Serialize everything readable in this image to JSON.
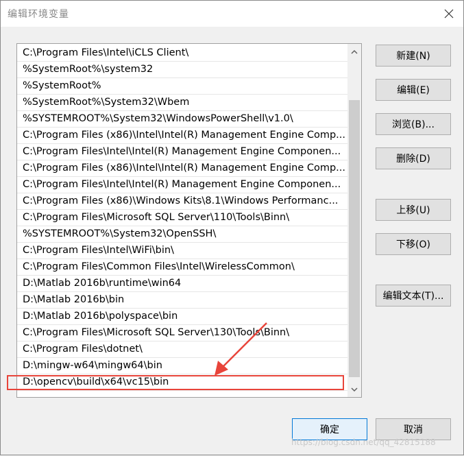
{
  "window": {
    "title": "编辑环境变量"
  },
  "list": {
    "items": [
      "C:\\Program Files\\Intel\\iCLS Client\\",
      "%SystemRoot%\\system32",
      "%SystemRoot%",
      "%SystemRoot%\\System32\\Wbem",
      "%SYSTEMROOT%\\System32\\WindowsPowerShell\\v1.0\\",
      "C:\\Program Files (x86)\\Intel\\Intel(R) Management Engine Comp...",
      "C:\\Program Files\\Intel\\Intel(R) Management Engine Componen...",
      "C:\\Program Files (x86)\\Intel\\Intel(R) Management Engine Comp...",
      "C:\\Program Files\\Intel\\Intel(R) Management Engine Componen...",
      "C:\\Program Files (x86)\\Windows Kits\\8.1\\Windows Performanc...",
      "C:\\Program Files\\Microsoft SQL Server\\110\\Tools\\Binn\\",
      "%SYSTEMROOT%\\System32\\OpenSSH\\",
      "C:\\Program Files\\Intel\\WiFi\\bin\\",
      "C:\\Program Files\\Common Files\\Intel\\WirelessCommon\\",
      "D:\\Matlab 2016b\\runtime\\win64",
      "D:\\Matlab 2016b\\bin",
      "D:\\Matlab 2016b\\polyspace\\bin",
      "C:\\Program Files\\Microsoft SQL Server\\130\\Tools\\Binn\\",
      "C:\\Program Files\\dotnet\\",
      "D:\\mingw-w64\\mingw64\\bin",
      "D:\\opencv\\build\\x64\\vc15\\bin"
    ]
  },
  "buttons": {
    "new": "新建(N)",
    "edit": "编辑(E)",
    "browse": "浏览(B)...",
    "delete": "删除(D)",
    "move_up": "上移(U)",
    "move_down": "下移(O)",
    "edit_text": "编辑文本(T)...",
    "ok": "确定",
    "cancel": "取消"
  },
  "watermark": "https://blog.csdn.net/qq_42815188",
  "colors": {
    "annotation": "#e8443a",
    "ok_border": "#0078d7"
  }
}
